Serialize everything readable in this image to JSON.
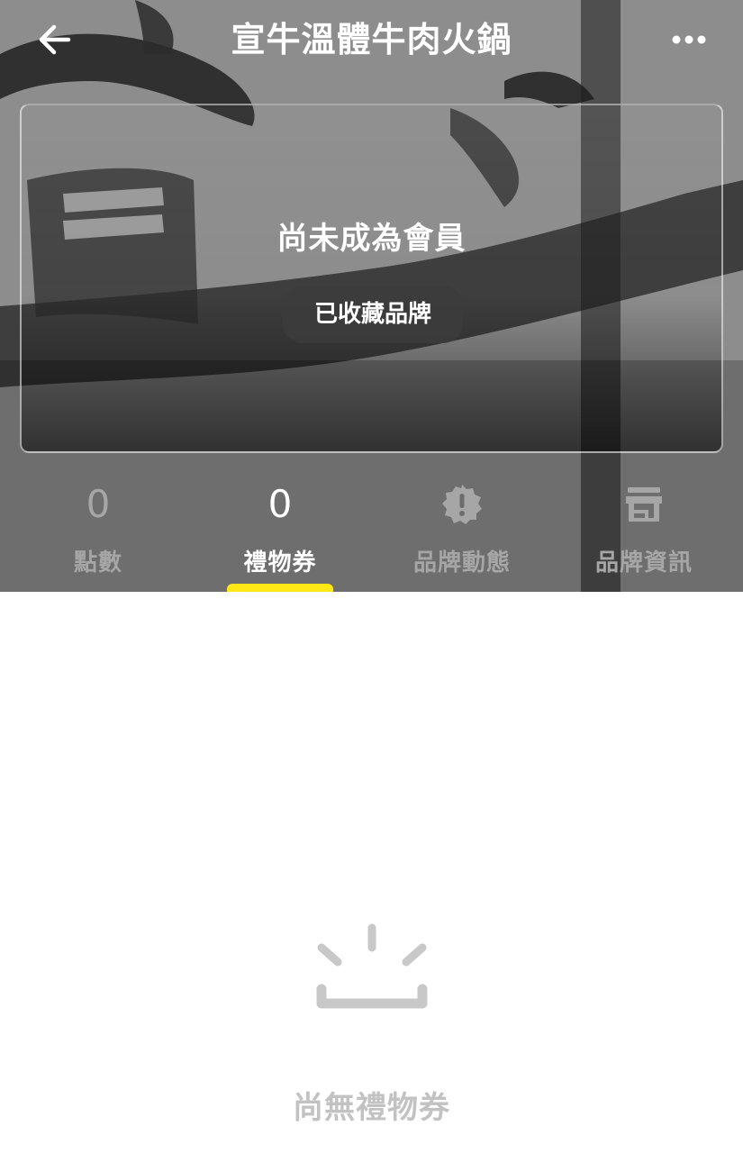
{
  "header": {
    "title": "宣牛溫體牛肉火鍋",
    "back_icon": "arrow-left-icon",
    "more_icon": "more-horizontal-icon"
  },
  "membership": {
    "status": "尚未成為會員",
    "favorite_button_label": "已收藏品牌"
  },
  "tabs": [
    {
      "label": "點數",
      "value": "0",
      "icon": "points-number",
      "active": false
    },
    {
      "label": "禮物券",
      "value": "0",
      "icon": "gift-voucher-number",
      "active": true
    },
    {
      "label": "品牌動態",
      "icon": "alert-badge-icon",
      "active": false
    },
    {
      "label": "品牌資訊",
      "icon": "store-icon",
      "active": false
    }
  ],
  "empty_state": {
    "icon": "empty-box-icon",
    "message": "尚無禮物券"
  },
  "colors": {
    "accent": "#ffe815",
    "active_text": "#ffffff",
    "inactive_text": "#a6a6a6",
    "empty_text": "#c2c2c2"
  }
}
